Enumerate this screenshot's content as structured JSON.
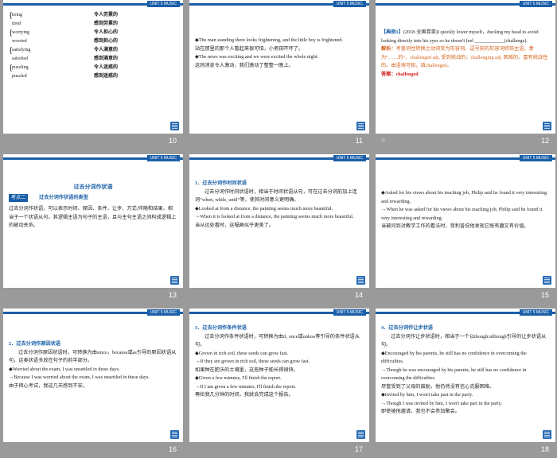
{
  "header_tag": "UNIT 5 MUSIC",
  "slides": [
    {
      "num": "10",
      "pairs": [
        {
          "en": "tiring",
          "zh": "令人劳累的"
        },
        {
          "en": "tired",
          "zh": "感到劳累的"
        },
        {
          "en": "worrying",
          "zh": "令人担心的"
        },
        {
          "en": "worried",
          "zh": "感到担心的"
        },
        {
          "en": "satisfying",
          "zh": "令人满意的"
        },
        {
          "en": "satisfied",
          "zh": "感到满意的"
        },
        {
          "en": "puzzling",
          "zh": "令人迷惑的"
        },
        {
          "en": "puzzled",
          "zh": "感到迷惑的"
        }
      ]
    },
    {
      "num": "11",
      "lines": [
        "◆The man standing there looks frightening, and the little boy is frightened.",
        "站在那里的那个人看起来很可怕，小男孩吓坏了。",
        "◆The news was exciting and we were excited the whole night.",
        "这则消息令人激动，我们激动了整整一晚上。"
      ]
    },
    {
      "num": "12",
      "example_label": "【典例1】",
      "example_text": "(2018·全国卷Ⅲ)I quickly lower myself，ducking my head to avoid looking directly into his eyes so he doesn't feel ____________(challenge).",
      "analysis_label": "解析：",
      "analysis_text": "考查词性转换之动词变为形容词。逗号前的形容词修饰主语，意为“……的”，challenged adj. 受到挑战的；challenging adj. 困难的，富有挑战性的。由语境可知，填challenged。",
      "answer_label": "答案：",
      "answer_text": "challenged"
    },
    {
      "num": "13",
      "title": "过去分词作状语",
      "box": "考点二",
      "subtitle": "过去分词作状语的类型",
      "text": "过去分词作状语，可以表示时间、原因、条件、让步、方式/伴随和结果，相当于一个状语从句。其逻辑主语为句子的主语，且与主句主语之间构成逻辑上的被动关系。"
    },
    {
      "num": "14",
      "heading": "1．过去分词作时间状语",
      "lines": [
        "过去分词作时间状语时，相当于时间状语从句，可在过去分词前加上连词“when, while, until”等，使其时间意义更明确。",
        "◆Looked at from a distance, the painting seems much more beautiful.",
        "→When it is looked at from a distance, the painting seems much more beautiful.",
        "当从远处看时，这幅画似乎更美了。"
      ]
    },
    {
      "num": "15",
      "lines": [
        "◆Asked for his views about his teaching job, Philip said he found it very interesting and rewarding.",
        "→When he was asked for his views about his teaching job, Philip said he found it very interesting and rewarding.",
        "当被问到对教学工作的看法时，菲利普说他发现它既有趣又有价值。"
      ]
    },
    {
      "num": "16",
      "heading": "2．过去分词作原因状语",
      "lines": [
        "过去分词作原因状语时，可转换为由since，because或as引导的原因状语从句，这类状语多放在句子的前半部分。",
        "◆Worried about the exam, I was unsettled in these days.",
        "→Because I was worried about the exam, I was unsettled in these days.",
        "由于担心考试，我这几天感到不安。"
      ]
    },
    {
      "num": "17",
      "heading": "3．过去分词作条件状语",
      "lines": [
        "过去分词作条件状语时，可转换为由if, once或unless等引导的条件状语从句。",
        "◆Grown in rich soil, these seeds can grow fast.",
        "→If they are grown in rich soil, these seeds can grow fast.",
        "如果种在肥沃的土壤里，这些种子能长得很快。",
        "◆Given a few minutes, I'll finish the report.",
        "→If I am given a few minutes, I'll finish the report.",
        "再给我几分钟的时间，我就会完成这个报告。"
      ]
    },
    {
      "num": "18",
      "heading": "4．过去分词作让步状语",
      "lines": [
        "过去分词作让步状语时，相当于一个以though/although引导的让步状语从句。",
        "◆Encouraged by his parents, he still has no confidence in overcoming the difficulties.",
        "→Though he was encouraged by his parents, he still has no confidence in overcoming the difficulties.",
        "尽管受到了父母的鼓励，他仍然没有信心克服困难。",
        "◆Invited by him, I won't take part in the party.",
        "→Though I was invited by him, I won't take part in the party.",
        "即使被他邀请，我也不会参加聚会。"
      ]
    }
  ]
}
